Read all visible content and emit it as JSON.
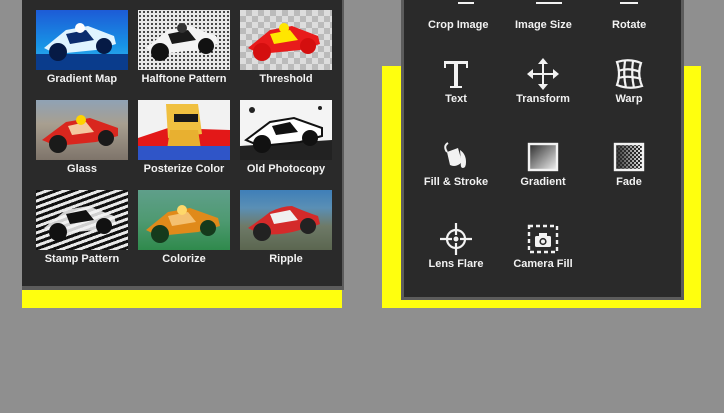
{
  "colors": {
    "highlight": "#ffff0e",
    "panel": "#2a2a2a",
    "background": "#8f8f8f",
    "text": "#f2f2f2"
  },
  "effects": [
    {
      "label": "Gradient Map",
      "thumb": "gradient-map"
    },
    {
      "label": "Halftone Pattern",
      "thumb": "halftone"
    },
    {
      "label": "Threshold",
      "thumb": "threshold"
    },
    {
      "label": "Glass",
      "thumb": "glass"
    },
    {
      "label": "Posterize Color",
      "thumb": "posterize"
    },
    {
      "label": "Old Photocopy",
      "thumb": "photocopy"
    },
    {
      "label": "Stamp Pattern",
      "thumb": "stamp"
    },
    {
      "label": "Colorize",
      "thumb": "colorize"
    },
    {
      "label": "Ripple",
      "thumb": "ripple"
    }
  ],
  "tools": {
    "top_row": [
      {
        "label": "Crop Image",
        "icon": "crop-icon"
      },
      {
        "label": "Image Size",
        "icon": "image-size-icon"
      },
      {
        "label": "Rotate",
        "icon": "rotate-icon"
      }
    ],
    "items": [
      {
        "label": "Text",
        "icon": "text-icon"
      },
      {
        "label": "Transform",
        "icon": "transform-move-icon"
      },
      {
        "label": "Warp",
        "icon": "warp-grid-icon"
      },
      {
        "label": "Fill & Stroke",
        "icon": "paint-bucket-icon"
      },
      {
        "label": "Gradient",
        "icon": "gradient-icon"
      },
      {
        "label": "Fade",
        "icon": "fade-icon"
      },
      {
        "label": "Lens Flare",
        "icon": "lens-flare-icon"
      },
      {
        "label": "Camera Fill",
        "icon": "camera-fill-icon"
      }
    ]
  }
}
